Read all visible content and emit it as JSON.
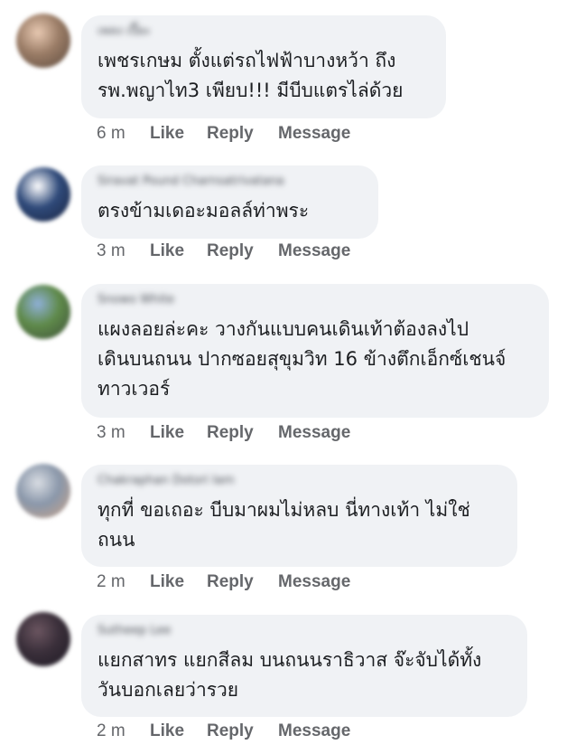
{
  "comments": [
    {
      "author": "เพลง เปี๊ยะ",
      "text": "เพชรเกษม ตั้งแต่รถไฟฟ้าบางหว้า ถึง\nรพ.พญาไท3 เพียบ!!! มีบีบแตรไล่ด้วย",
      "time": "6 m",
      "like": "Like",
      "reply": "Reply",
      "message": "Message",
      "avatar_colors": [
        "#e8c9b2",
        "#9a7c66",
        "#5c4a3e"
      ]
    },
    {
      "author": "Siravat Pound Charnsatrivatana",
      "text": "ตรงข้ามเดอะมอลล์ท่าพระ",
      "time": "3 m",
      "like": "Like",
      "reply": "Reply",
      "message": "Message",
      "avatar_colors": [
        "#ffffff",
        "#2f4a7a",
        "#1a2440"
      ]
    },
    {
      "author": "Snowo White",
      "text": "แผงลอยล่ะคะ วางกันแบบคนเดินเท้าต้องลงไป\nเดินบนถนน ปากซอยสุขุมวิท 16 ข้างตึกเอ็กซ์เชนจ์\nทาวเวอร์",
      "time": "3 m",
      "like": "Like",
      "reply": "Reply",
      "message": "Message",
      "avatar_colors": [
        "#8fb0d8",
        "#5f8a4a",
        "#3d4f3a"
      ]
    },
    {
      "author": "Chakraphan Dotori Iam",
      "text": "ทุกที่ ขอเถอะ บีบมาผมไม่หลบ นี่ทางเท้า ไม่ใช่\nถนน",
      "time": "2 m",
      "like": "Like",
      "reply": "Reply",
      "message": "Message",
      "avatar_colors": [
        "#d9dde3",
        "#8a97aa",
        "#c9a48a"
      ]
    },
    {
      "author": "Sutheep Lee",
      "text": "แยกสาทร แยกสีลม บนถนนราธิวาส จ๊ะจับได้ทั้ง\nวันบอกเลยว่ารวย",
      "time": "2 m",
      "like": "Like",
      "reply": "Reply",
      "message": "Message",
      "avatar_colors": [
        "#6b5560",
        "#3a2f3a",
        "#1e1a24"
      ]
    }
  ]
}
